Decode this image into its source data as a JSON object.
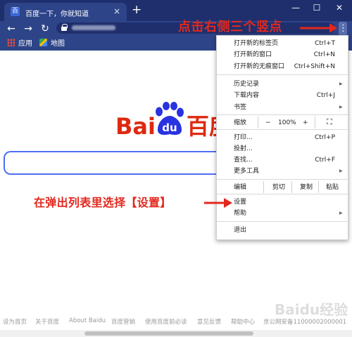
{
  "browser": {
    "tab_title": "百度一下，你就知道",
    "favicon_label": "百",
    "tab_close": "×",
    "new_tab": "+",
    "window_minimize": "—",
    "window_maximize": "☐",
    "window_close": "✕",
    "back": "←",
    "forward": "→",
    "reload": "↻",
    "menu_button": "⋮"
  },
  "bookmarks": [
    {
      "label": "应用",
      "icon": "apps-grid-icon"
    },
    {
      "label": "地图",
      "icon": "maps-icon"
    }
  ],
  "page": {
    "logo_left": "Bai",
    "logo_du": "du",
    "logo_right": "百度",
    "footer_links": [
      "设为首页",
      "关于百度",
      "About Baidu",
      "百度营销",
      "使用百度前必读",
      "意见反馈",
      "帮助中心",
      "京公网安备11000002000001"
    ]
  },
  "menu": {
    "new_tab": "打开新的标签页",
    "new_tab_shortcut": "Ctrl+T",
    "new_window": "打开新的窗口",
    "new_window_shortcut": "Ctrl+N",
    "incognito": "打开新的无痕窗口",
    "incognito_shortcut": "Ctrl+Shift+N",
    "history": "历史记录",
    "downloads": "下载内容",
    "downloads_shortcut": "Ctrl+J",
    "bookmarks": "书签",
    "zoom_label": "缩放",
    "zoom_minus": "−",
    "zoom_value": "100%",
    "zoom_plus": "+",
    "fullscreen": "⛶",
    "print": "打印...",
    "print_shortcut": "Ctrl+P",
    "cast": "投射...",
    "find": "查找...",
    "find_shortcut": "Ctrl+F",
    "more_tools": "更多工具",
    "edit_label": "编辑",
    "cut": "剪切",
    "copy": "复制",
    "paste": "粘贴",
    "settings": "设置",
    "help": "帮助",
    "exit": "退出",
    "submenu_arrow": "▶"
  },
  "annotations": {
    "top": "点击右侧三个竖点",
    "middle": "在弹出列表里选择【设置】",
    "watermark": "Baidu经验"
  },
  "colors": {
    "titlebar": "#1f2f6d",
    "toolbar": "#2e4489",
    "annotation_red": "#e3281e",
    "baidu_red": "#de2910",
    "baidu_blue": "#2932e1",
    "search_border": "#4e6ef2"
  }
}
